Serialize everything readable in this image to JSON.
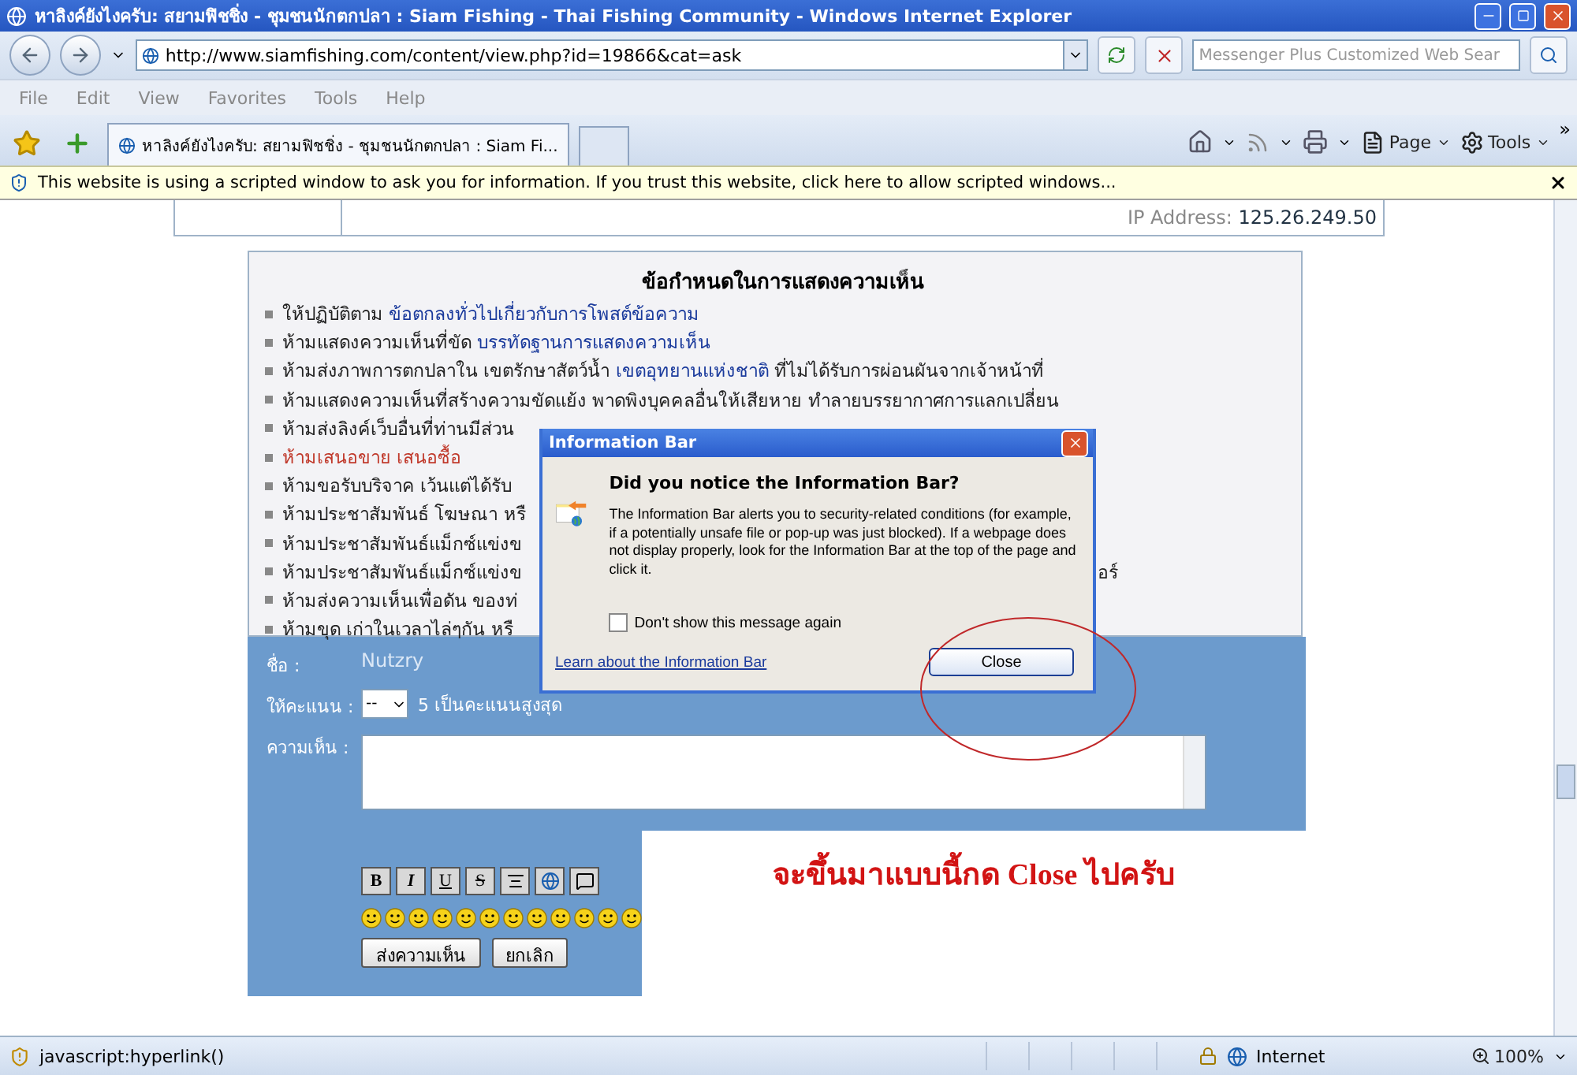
{
  "window": {
    "title": "หาลิงค์ยังไงครับ: สยามฟิชชิ่ง - ชุมชนนักตกปลา : Siam Fishing - Thai Fishing Community - Windows Internet Explorer"
  },
  "address_bar": {
    "url": "http://www.siamfishing.com/content/view.php?id=19866&cat=ask"
  },
  "search": {
    "placeholder": "Messenger Plus Customized Web Sear"
  },
  "menu": [
    "File",
    "Edit",
    "View",
    "Favorites",
    "Tools",
    "Help"
  ],
  "tabs": [
    {
      "label": "หาลิงค์ยังไงครับ: สยามฟิชชิ่ง - ชุมชนนักตกปลา : Siam Fi...",
      "selected": true
    }
  ],
  "command_bar": {
    "page": "Page",
    "tools": "Tools",
    "more": "»"
  },
  "info_bar": {
    "message": "This website is using a scripted window to ask you for information. If you trust this website, click here to allow scripted windows..."
  },
  "page": {
    "ip_label": "IP Address:",
    "ip": "125.26.249.50",
    "rules_title": "ข้อกำหนดในการแสดงความเห็น",
    "rules": [
      {
        "text": "ให้ปฏิบัติตาม ",
        "link": "ข้อตกลงทั่วไปเกี่ยวกับการโพสต์ข้อความ",
        "color": "#222222"
      },
      {
        "text": "ห้ามแสดงความเห็นที่ขัด ",
        "link": "บรรทัดฐานการแสดงความเห็น",
        "color": "#222222"
      },
      {
        "text": "ห้ามส่งภาพการตกปลาใน เขตรักษาสัตว์น้ำ ",
        "link": "เขตอุทยานแห่งชาติ",
        "after": " ที่ไม่ได้รับการผ่อนผันจากเจ้าหน้าที่",
        "color": "#222222"
      },
      {
        "text": "ห้ามแสดงความเห็นที่สร้างความขัดแย้ง พาดพิงบุคคลอื่นให้เสียหาย ทำลายบรรยากาศการแลกเปลี่ยน",
        "color": "#222222"
      },
      {
        "text": "ห้ามส่งลิงค์เว็บอื่นที่ท่านมีส่วน",
        "color": "#222222"
      },
      {
        "text": "ห้ามเสนอขาย เสนอซื้อ",
        "color": "#c0392b"
      },
      {
        "text": "ห้ามขอรับบริจาค เว้นแต่ได้รับ",
        "color": "#222222"
      },
      {
        "text": "ห้ามประชาสัมพันธ์ โฆษณา หรื",
        "color": "#222222"
      },
      {
        "text": "ห้ามประชาสัมพันธ์แม็กซ์แข่งข",
        "color": "#222222"
      },
      {
        "text": "ห้ามประชาสัมพันธ์แม็กซ์แข่งข",
        "tail": "อร์",
        "color": "#222222"
      },
      {
        "text": "ห้ามส่งความเห็นเพื่อดัน ของท่",
        "color": "#222222"
      },
      {
        "text": "ห้ามขุด เก่าในเวลาไล่ๆกัน หรื",
        "color": "#222222"
      }
    ],
    "form": {
      "name_label": "ชื่อ :",
      "name": "Nutzry",
      "rating_label": "ให้คะแนน :",
      "rating": "--",
      "rating_hint": "5 เป็นคะแนนสูงสุด",
      "comment_label": "ความเห็น :",
      "toolbar": [
        {
          "kind": "bold",
          "label": "B"
        },
        {
          "kind": "italic",
          "label": "I"
        },
        {
          "kind": "underline",
          "label": "U"
        },
        {
          "kind": "strike",
          "label": "S"
        },
        {
          "kind": "center"
        },
        {
          "kind": "image"
        },
        {
          "kind": "quote"
        }
      ],
      "submit": "ส่งความเห็น",
      "cancel": "ยกเลิก"
    }
  },
  "dialog": {
    "title": "Information Bar",
    "heading": "Did you notice the Information Bar?",
    "body": "The Information Bar alerts you to security-related conditions (for example, if a potentially unsafe file or pop-up was just blocked). If a webpage does not display properly, look for the Information Bar at the top of the page and click it.",
    "checkbox": {
      "label": "Don't show this message again",
      "checked": false
    },
    "link": "Learn about the Information Bar",
    "button": "Close"
  },
  "annotation": {
    "caption": "จะขึ้นมาแบบนี้กด Close ไปครับ"
  },
  "status_bar": {
    "text": "javascript:hyperlink()",
    "zone": "Internet",
    "zoom": "100%"
  }
}
